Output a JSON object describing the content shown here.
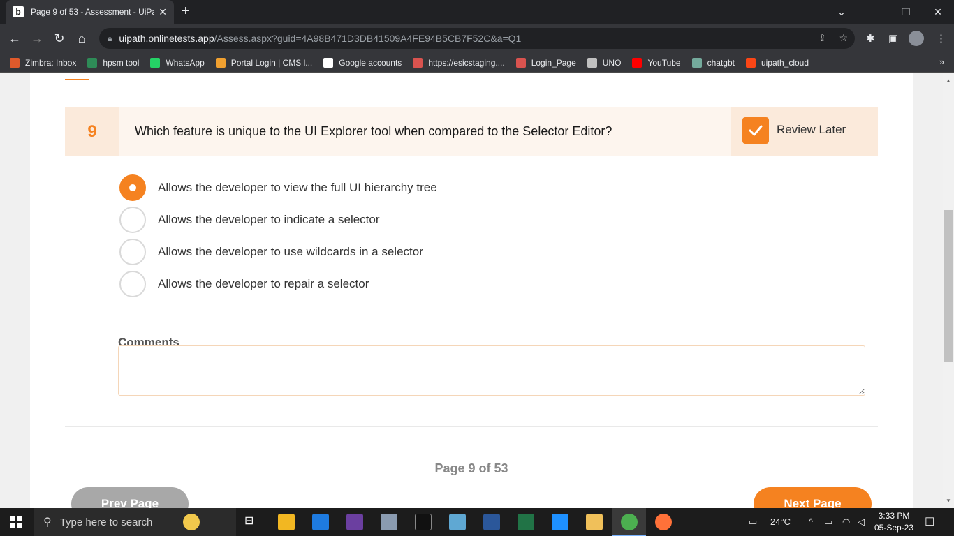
{
  "browser": {
    "tab_title": "Page 9 of 53 - Assessment - UiPa",
    "tab_favicon": "b",
    "url_host": "uipath.onlinetests.app",
    "url_path": "/Assess.aspx?guid=4A98B471D3DB41509A4FE94B5CB7F52C&a=Q1",
    "bookmarks": [
      {
        "label": "Zimbra: Inbox",
        "color": "#e05a2b"
      },
      {
        "label": "hpsm tool",
        "color": "#2e8b57"
      },
      {
        "label": "WhatsApp",
        "color": "#25d366"
      },
      {
        "label": "Portal Login | CMS l...",
        "color": "#f0a030"
      },
      {
        "label": "Google accounts",
        "color": "#ffffff"
      },
      {
        "label": "https://esicstaging....",
        "color": "#d9534f"
      },
      {
        "label": "Login_Page",
        "color": "#d9534f"
      },
      {
        "label": "UNO",
        "color": "#c0c0c0"
      },
      {
        "label": "YouTube",
        "color": "#ff0000"
      },
      {
        "label": "chatgbt",
        "color": "#74aa9c"
      },
      {
        "label": "uipath_cloud",
        "color": "#fa4616"
      }
    ],
    "bookmarks_more": "»"
  },
  "question": {
    "number": "9",
    "text": "Which feature is unique to the UI Explorer tool when compared to the Selector Editor?",
    "review_label": "Review Later",
    "review_checked": true,
    "options": [
      {
        "label": "Allows the developer to view the full UI hierarchy tree",
        "selected": true
      },
      {
        "label": "Allows the developer to indicate a selector",
        "selected": false
      },
      {
        "label": "Allows the developer to use wildcards in a selector",
        "selected": false
      },
      {
        "label": "Allows the developer to repair a selector",
        "selected": false
      }
    ]
  },
  "comments": {
    "label": "Comments",
    "value": ""
  },
  "pager": {
    "info": "Page 9 of 53",
    "prev_label": "Prev Page",
    "next_label": "Next Page"
  },
  "taskbar": {
    "search_placeholder": "Type here to search",
    "weather": "24°C",
    "time": "3:33 PM",
    "date": "05-Sep-23"
  },
  "colors": {
    "accent": "#f58220",
    "question_bg": "#fdf5ee"
  }
}
